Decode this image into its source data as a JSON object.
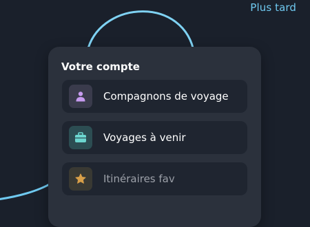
{
  "header": {
    "later_label": "Plus tard"
  },
  "account_card": {
    "title": "Votre compte",
    "items": [
      {
        "label": "Compagnons de voyage",
        "icon": "person-icon",
        "icon_color": "#c79bf0"
      },
      {
        "label": "Voyages à venir",
        "icon": "suitcase-icon",
        "icon_color": "#6cd6cf"
      },
      {
        "label": "Itinéraires fav",
        "icon": "star-icon",
        "icon_color": "#e7a94b"
      }
    ]
  },
  "colors": {
    "background": "#1a202b",
    "card": "#2b313c",
    "accent": "#6fc9f0"
  }
}
